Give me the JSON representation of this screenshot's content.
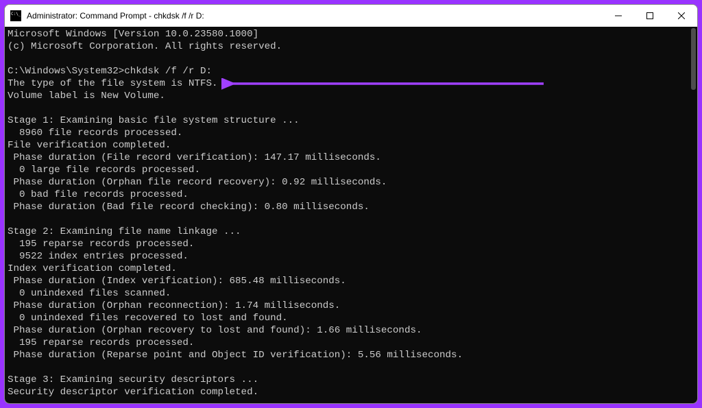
{
  "titlebar": {
    "title": "Administrator: Command Prompt - chkdsk  /f /r D:"
  },
  "terminal": {
    "lines": [
      "Microsoft Windows [Version 10.0.23580.1000]",
      "(c) Microsoft Corporation. All rights reserved.",
      "",
      "C:\\Windows\\System32>chkdsk /f /r D:",
      "The type of the file system is NTFS.",
      "Volume label is New Volume.",
      "",
      "Stage 1: Examining basic file system structure ...",
      "  8960 file records processed.",
      "File verification completed.",
      " Phase duration (File record verification): 147.17 milliseconds.",
      "  0 large file records processed.",
      " Phase duration (Orphan file record recovery): 0.92 milliseconds.",
      "  0 bad file records processed.",
      " Phase duration (Bad file record checking): 0.80 milliseconds.",
      "",
      "Stage 2: Examining file name linkage ...",
      "  195 reparse records processed.",
      "  9522 index entries processed.",
      "Index verification completed.",
      " Phase duration (Index verification): 685.48 milliseconds.",
      "  0 unindexed files scanned.",
      " Phase duration (Orphan reconnection): 1.74 milliseconds.",
      "  0 unindexed files recovered to lost and found.",
      " Phase duration (Orphan recovery to lost and found): 1.66 milliseconds.",
      "  195 reparse records processed.",
      " Phase duration (Reparse point and Object ID verification): 5.56 milliseconds.",
      "",
      "Stage 3: Examining security descriptors ...",
      "Security descriptor verification completed."
    ]
  },
  "annotation": {
    "color": "#a040ff"
  }
}
